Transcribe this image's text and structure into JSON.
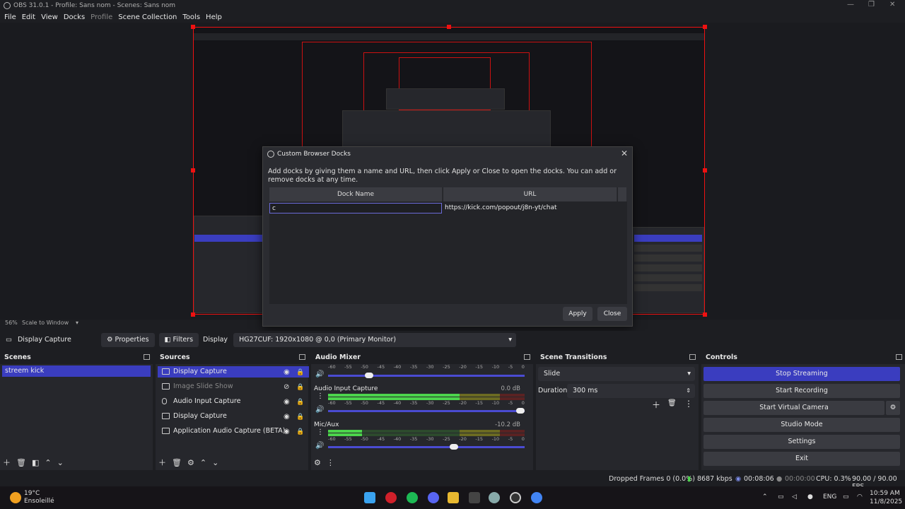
{
  "window": {
    "title": "OBS 31.0.1 - Profile: Sans nom - Scenes: Sans nom"
  },
  "menu": [
    "File",
    "Edit",
    "View",
    "Docks",
    "Profile",
    "Scene Collection",
    "Tools",
    "Help"
  ],
  "dialog": {
    "title": "Custom Browser Docks",
    "description": "Add docks by giving them a name and URL, then click Apply or Close to open the docks. You can add or remove docks at any time.",
    "col_name": "Dock Name",
    "col_url": "URL",
    "row_name": "c",
    "row_url": "https://kick.com/popout/j8n-yt/chat",
    "apply": "Apply",
    "close": "Close"
  },
  "scale": {
    "zoom": "56%",
    "mode": "Scale to Window"
  },
  "toolbar": {
    "source": "Display Capture",
    "properties": "Properties",
    "filters": "Filters",
    "display_label": "Display",
    "display_value": "HG27CUF: 1920x1080 @ 0,0 (Primary Monitor)"
  },
  "scenes": {
    "title": "Scenes",
    "items": [
      "streem kick"
    ]
  },
  "sources": {
    "title": "Sources",
    "items": [
      "Display Capture",
      "Image Slide Show",
      "Audio Input Capture",
      "Display Capture",
      "Application Audio Capture (BETA)"
    ]
  },
  "mixer": {
    "title": "Audio Mixer",
    "ticks": [
      "-60",
      "-55",
      "-50",
      "-45",
      "-40",
      "-35",
      "-30",
      "-25",
      "-20",
      "-15",
      "-10",
      "-5",
      "0"
    ],
    "channels": [
      {
        "name": "Audio Input Capture",
        "db": "0.0 dB"
      },
      {
        "name": "Mic/Aux",
        "db": "-10.2 dB"
      }
    ]
  },
  "transitions": {
    "title": "Scene Transitions",
    "selected": "Slide",
    "duration_label": "Duration",
    "duration_value": "300 ms"
  },
  "controls": {
    "title": "Controls",
    "buttons": [
      "Stop Streaming",
      "Start Recording",
      "Start Virtual Camera",
      "Studio Mode",
      "Settings",
      "Exit"
    ]
  },
  "status": {
    "dropped": "Dropped Frames 0 (0.0%)",
    "bitrate": "8687 kbps",
    "stream_time": "00:08:06",
    "rec_time": "00:00:00",
    "cpu": "CPU: 0.3%",
    "fps": "90.00 / 90.00 FPS"
  },
  "taskbar": {
    "weather_temp": "19°C",
    "weather_desc": "Ensoleillé",
    "lang": "ENG",
    "time": "10:59 AM",
    "date": "11/8/2025"
  }
}
